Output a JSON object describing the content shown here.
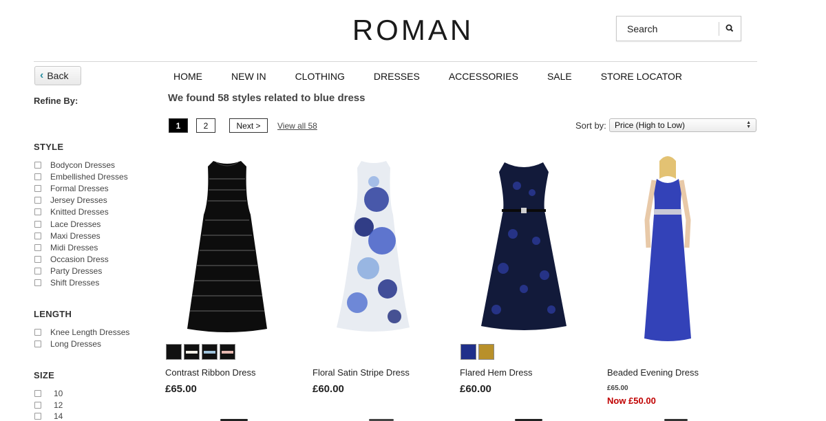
{
  "brand": {
    "logo": "ROMAN"
  },
  "search": {
    "placeholder": "Search"
  },
  "back": {
    "label": "Back"
  },
  "nav": [
    "HOME",
    "NEW IN",
    "CLOTHING",
    "DRESSES",
    "ACCESSORIES",
    "SALE",
    "STORE LOCATOR"
  ],
  "refine_label": "Refine By:",
  "results_text": "We found 58 styles related to blue dress",
  "pagination": {
    "current": "1",
    "page2": "2",
    "next": "Next >",
    "view_all": "View all 58"
  },
  "sort": {
    "label": "Sort by:",
    "selected": "Price (High to Low)"
  },
  "filters": {
    "style": {
      "title": "STYLE",
      "items": [
        "Bodycon Dresses",
        "Embellished Dresses",
        "Formal Dresses",
        "Jersey Dresses",
        "Knitted Dresses",
        "Lace Dresses",
        "Maxi Dresses",
        "Midi Dresses",
        "Occasion Dress",
        "Party Dresses",
        "Shift Dresses"
      ]
    },
    "length": {
      "title": "LENGTH",
      "items": [
        "Knee Length Dresses",
        "Long Dresses"
      ]
    },
    "size": {
      "title": "SIZE",
      "items": [
        "10",
        "12",
        "14"
      ]
    }
  },
  "products": [
    {
      "name": "Contrast Ribbon Dress",
      "price": "£65.00",
      "swatches": [
        "#111111",
        "#f4f0e8",
        "#9fc3dc",
        "#e6b8b0"
      ]
    },
    {
      "name": "Floral Satin Stripe Dress",
      "price": "£60.00",
      "swatches": []
    },
    {
      "name": "Flared Hem Dress",
      "price": "£60.00",
      "swatches": [
        "#1f2f8a",
        "#b8902a"
      ]
    },
    {
      "name": "Beaded Evening Dress",
      "price_was": "£65.00",
      "price_now": "Now £50.00",
      "swatches": []
    }
  ],
  "colors": {
    "sale": "#c00000",
    "accent": "#2a8ea0",
    "rule": "#d6d6d6"
  }
}
